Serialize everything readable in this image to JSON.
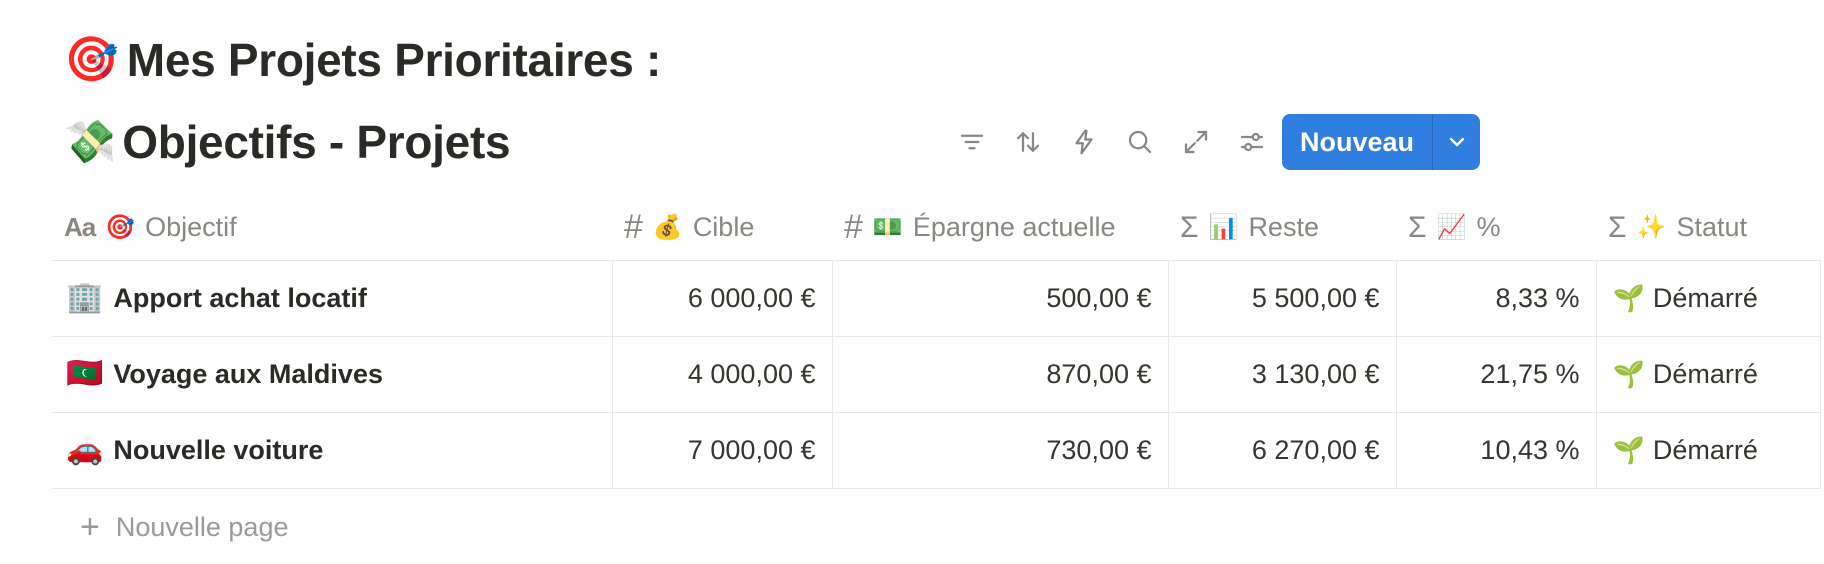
{
  "page": {
    "heading_emoji": "🎯",
    "heading": "Mes Projets Prioritaires :"
  },
  "database": {
    "title_emoji": "💸",
    "title": "Objectifs - Projets",
    "toolbar_icons": [
      "filter-icon",
      "sort-icon",
      "automation-icon",
      "search-icon",
      "expand-icon",
      "settings-icon"
    ],
    "new_button_label": "Nouveau",
    "accent_color": "#2f7ee0",
    "columns": [
      {
        "type_icon": "Aa",
        "emoji": "🎯",
        "label": "Objectif"
      },
      {
        "type_icon": "#",
        "emoji": "💰",
        "label": "Cible"
      },
      {
        "type_icon": "#",
        "emoji": "💵",
        "label": "Épargne actuelle"
      },
      {
        "type_icon": "Σ",
        "emoji": "📊",
        "label": "Reste"
      },
      {
        "type_icon": "Σ",
        "emoji": "📈",
        "label": "%"
      },
      {
        "type_icon": "Σ",
        "emoji": "✨",
        "label": "Statut"
      }
    ],
    "rows": [
      {
        "emoji": "🏢",
        "name": "Apport achat locatif",
        "cible": "6 000,00 €",
        "epargne": "500,00 €",
        "reste": "5 500,00 €",
        "pct": "8,33 %",
        "status_emoji": "🌱",
        "status": "Démarré"
      },
      {
        "emoji": "🇲🇻",
        "name": "Voyage aux Maldives",
        "cible": "4 000,00 €",
        "epargne": "870,00 €",
        "reste": "3 130,00 €",
        "pct": "21,75 %",
        "status_emoji": "🌱",
        "status": "Démarré"
      },
      {
        "emoji": "🚗",
        "name": "Nouvelle voiture",
        "cible": "7 000,00 €",
        "epargne": "730,00 €",
        "reste": "6 270,00 €",
        "pct": "10,43 %",
        "status_emoji": "🌱",
        "status": "Démarré"
      }
    ],
    "new_page_label": "Nouvelle page"
  }
}
